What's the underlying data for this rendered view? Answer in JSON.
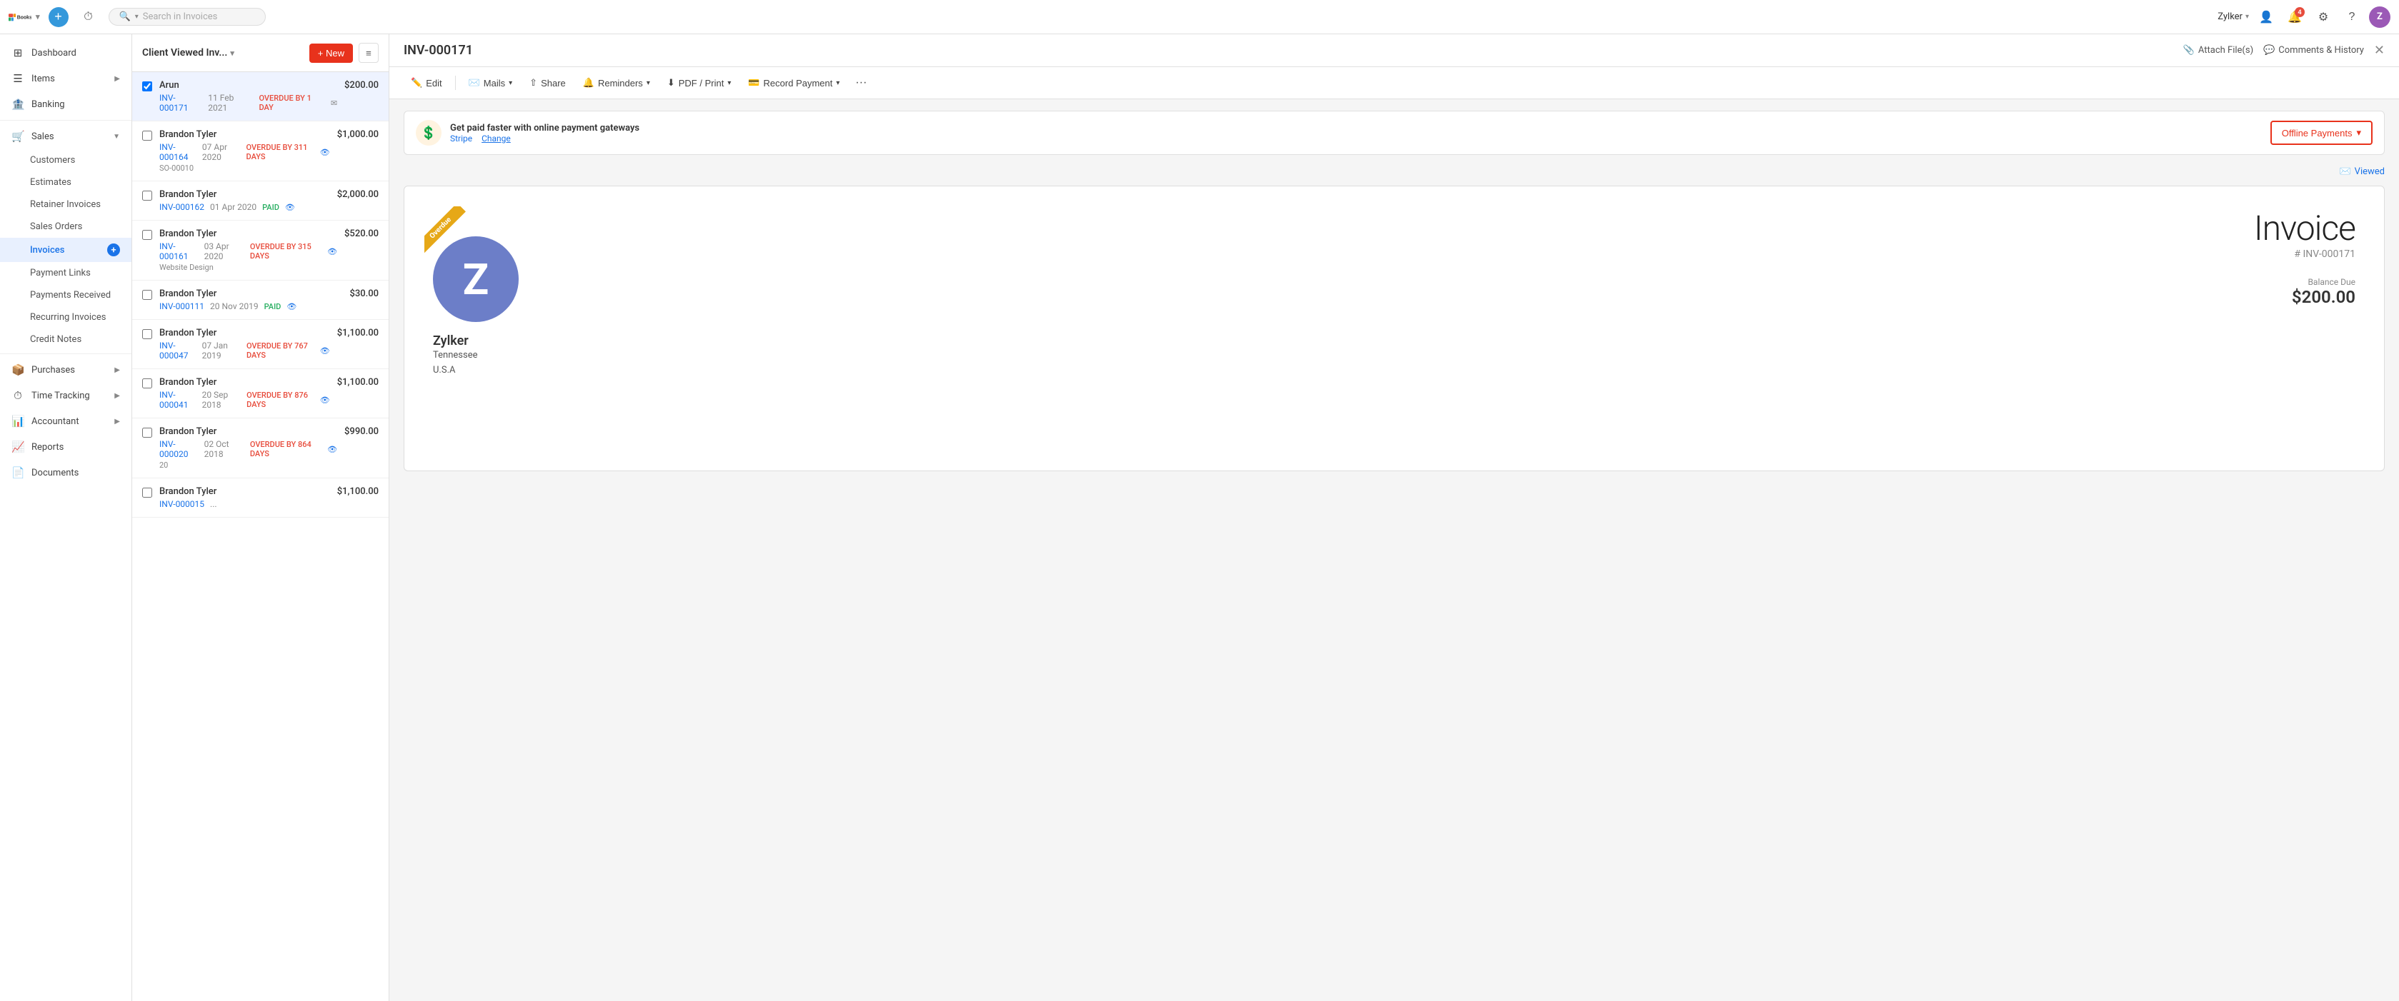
{
  "app": {
    "name": "Books",
    "logo_text": "zoho",
    "dropdown_caret": "▾"
  },
  "topnav": {
    "add_tooltip": "+",
    "history_icon": "⟳",
    "search_placeholder": "Search in Invoices",
    "search_filter": "▾",
    "user_name": "Zylker",
    "notifications_count": "4",
    "settings_icon": "⚙",
    "help_icon": "?",
    "avatar_initial": "Z"
  },
  "sidebar": {
    "items": [
      {
        "id": "dashboard",
        "label": "Dashboard",
        "icon": "⊞"
      },
      {
        "id": "items",
        "label": "Items",
        "icon": "☰",
        "has_arrow": true
      },
      {
        "id": "banking",
        "label": "Banking",
        "icon": "🏦"
      },
      {
        "id": "sales",
        "label": "Sales",
        "icon": "🛒",
        "expanded": true,
        "has_arrow": true
      },
      {
        "id": "purchases",
        "label": "Purchases",
        "icon": "📦",
        "has_arrow": true
      },
      {
        "id": "time-tracking",
        "label": "Time Tracking",
        "icon": "⏱",
        "has_arrow": true
      },
      {
        "id": "accountant",
        "label": "Accountant",
        "icon": "📊",
        "has_arrow": true
      },
      {
        "id": "reports",
        "label": "Reports",
        "icon": "📈"
      },
      {
        "id": "documents",
        "label": "Documents",
        "icon": "📄"
      }
    ],
    "sub_items": [
      {
        "id": "customers",
        "label": "Customers"
      },
      {
        "id": "estimates",
        "label": "Estimates"
      },
      {
        "id": "retainer-invoices",
        "label": "Retainer Invoices"
      },
      {
        "id": "sales-orders",
        "label": "Sales Orders"
      },
      {
        "id": "invoices",
        "label": "Invoices",
        "active": true
      },
      {
        "id": "payment-links",
        "label": "Payment Links"
      },
      {
        "id": "payments-received",
        "label": "Payments Received"
      },
      {
        "id": "recurring-invoices",
        "label": "Recurring Invoices"
      },
      {
        "id": "credit-notes",
        "label": "Credit Notes"
      }
    ]
  },
  "list_panel": {
    "title": "Client Viewed Inv...",
    "title_caret": "▾",
    "new_button": "+ New",
    "items": [
      {
        "name": "Arun",
        "inv_num": "INV-000171",
        "date": "11 Feb 2021",
        "amount": "$200.00",
        "status": "OVERDUE BY 1 DAY",
        "status_type": "overdue",
        "has_mail": true,
        "selected": true
      },
      {
        "name": "Brandon Tyler",
        "inv_num": "INV-000164",
        "date": "07 Apr 2020",
        "amount": "$1,000.00",
        "status": "OVERDUE BY 311 DAYS",
        "status_type": "overdue",
        "ref": "SO-00010",
        "has_eye": true
      },
      {
        "name": "Brandon Tyler",
        "inv_num": "INV-000162",
        "date": "01 Apr 2020",
        "amount": "$2,000.00",
        "status": "PAID",
        "status_type": "paid",
        "has_eye": true
      },
      {
        "name": "Brandon Tyler",
        "inv_num": "INV-000161",
        "date": "03 Apr 2020",
        "amount": "$520.00",
        "status": "OVERDUE BY 315 DAYS",
        "status_type": "overdue",
        "ref": "Website Design",
        "has_eye": true
      },
      {
        "name": "Brandon Tyler",
        "inv_num": "INV-000111",
        "date": "20 Nov 2019",
        "amount": "$30.00",
        "status": "PAID",
        "status_type": "paid",
        "has_eye": true
      },
      {
        "name": "Brandon Tyler",
        "inv_num": "INV-000047",
        "date": "07 Jan 2019",
        "amount": "$1,100.00",
        "status": "OVERDUE BY 767 DAYS",
        "status_type": "overdue",
        "has_eye": true
      },
      {
        "name": "Brandon Tyler",
        "inv_num": "INV-000041",
        "date": "20 Sep 2018",
        "amount": "$1,100.00",
        "status": "OVERDUE BY 876 DAYS",
        "status_type": "overdue",
        "has_eye": true
      },
      {
        "name": "Brandon Tyler",
        "inv_num": "INV-000020",
        "date": "02 Oct 2018",
        "amount": "$990.00",
        "status": "OVERDUE BY 864 DAYS",
        "status_type": "overdue",
        "ref": "20",
        "has_eye": true
      },
      {
        "name": "Brandon Tyler",
        "inv_num": "INV-000015",
        "date": "...",
        "amount": "$1,100.00",
        "status": "",
        "status_type": ""
      }
    ]
  },
  "detail": {
    "inv_number": "INV-000171",
    "attach_label": "Attach File(s)",
    "comments_label": "Comments & History",
    "toolbar": {
      "edit": "Edit",
      "mails": "Mails",
      "share": "Share",
      "reminders": "Reminders",
      "pdf_print": "PDF / Print",
      "record_payment": "Record Payment",
      "more": "···"
    },
    "banner": {
      "title": "Get paid faster with online payment gateways",
      "stripe_label": "Stripe",
      "change_label": "Change",
      "offline_btn": "Offline Payments",
      "offline_caret": "▾"
    },
    "viewed_label": "Viewed",
    "ribbon_label": "Overdue",
    "invoice": {
      "heading": "Invoice",
      "number": "# INV-000171",
      "balance_label": "Balance Due",
      "balance_amount": "$200.00",
      "company_initial": "Z",
      "company_name": "Zylker",
      "company_state": "Tennessee",
      "company_country": "U.S.A"
    }
  }
}
